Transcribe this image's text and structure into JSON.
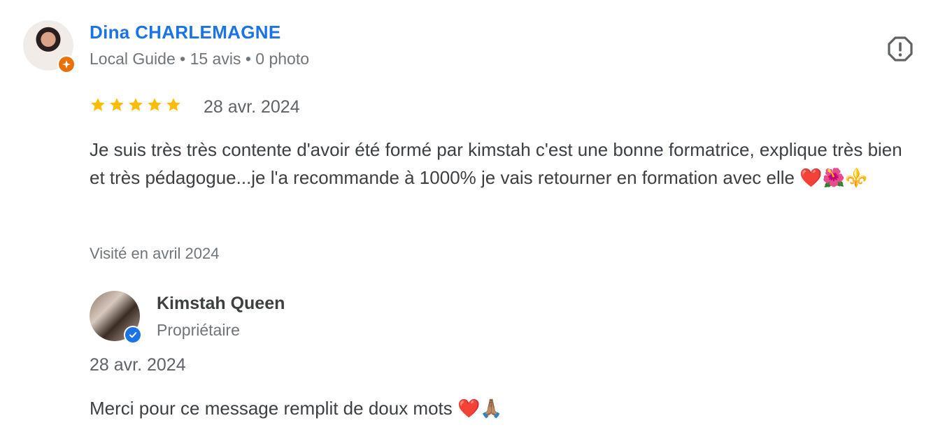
{
  "review": {
    "author_name": "Dina CHARLEMAGNE",
    "author_meta": "Local Guide • 15 avis • 0 photo",
    "rating": 5,
    "rating_max": 5,
    "date": "28 avr. 2024",
    "text": "Je suis très très contente d'avoir été formé par kimstah c'est une bonne formatrice, explique très bien et très pédagogue...je l'a recommande à 1000% je vais retourner en formation avec elle ❤️🌺⚜️",
    "visited": "Visité en avril 2024"
  },
  "owner_response": {
    "name": "Kimstah Queen",
    "role": "Propriétaire",
    "date": "28 avr. 2024",
    "text": "Merci pour ce message remplit de doux mots ❤️🙏🏽"
  },
  "icons": {
    "report": "report-flag-icon",
    "star": "star-icon",
    "local_guide_badge": "local-guide-badge-icon",
    "verified_badge": "verified-check-icon"
  },
  "colors": {
    "author_name": "#1a73e8",
    "star": "#fbbc04",
    "local_guide_badge": "#e8710a",
    "verified_badge": "#1a73e8"
  }
}
